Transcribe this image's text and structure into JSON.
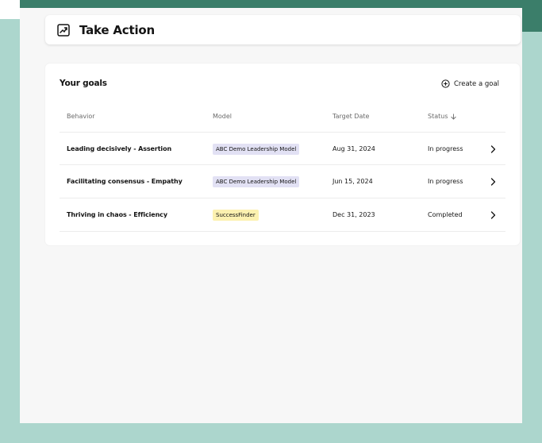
{
  "colors": {
    "teal_dark": "#3b7e6a",
    "teal_light": "#acd6cd",
    "tag_purple": "#e2e1f4",
    "tag_yellow": "#fcf1b0"
  },
  "header": {
    "icon": "trending-up-icon",
    "title": "Take Action"
  },
  "goals": {
    "title": "Your goals",
    "create_label": "Create a goal",
    "create_icon": "plus-circle-icon",
    "columns": {
      "behavior": "Behavior",
      "model": "Model",
      "target_date": "Target Date",
      "status": "Status"
    },
    "sort_icon": "arrow-down-icon",
    "rows": [
      {
        "behavior": "Leading decisively - Assertion",
        "model": "ABC Demo Leadership Model",
        "model_color": "purple",
        "target_date": "Aug 31, 2024",
        "status": "In progress"
      },
      {
        "behavior": "Facilitating consensus - Empathy",
        "model": "ABC Demo Leadership Model",
        "model_color": "purple",
        "target_date": "Jun 15, 2024",
        "status": "In progress"
      },
      {
        "behavior": "Thriving in chaos - Efficiency",
        "model": "SuccessFinder",
        "model_color": "yellow",
        "target_date": "Dec 31, 2023",
        "status": "Completed"
      }
    ]
  }
}
